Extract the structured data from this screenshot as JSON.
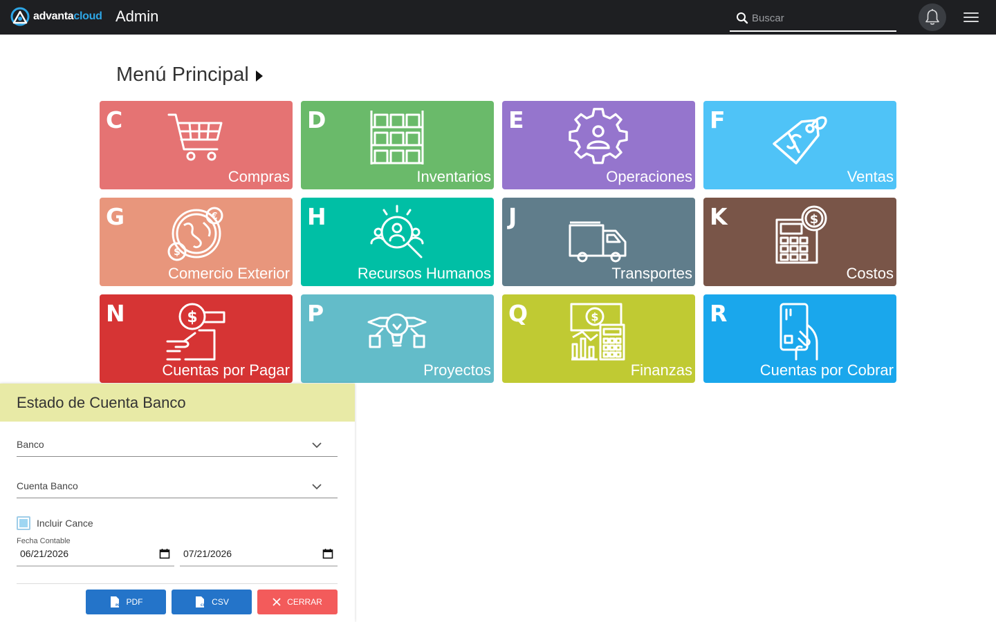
{
  "header": {
    "logo_part1": "advanta",
    "logo_part2": "cloud",
    "title": "Admin",
    "search_placeholder": "Buscar"
  },
  "menu": {
    "title": "Menú Principal"
  },
  "tiles": [
    {
      "letter": "C",
      "label": "Compras",
      "color": "#e57373",
      "icon": "shopping-cart-icon"
    },
    {
      "letter": "D",
      "label": "Inventarios",
      "color": "#6aba6a",
      "icon": "boxes-shelf-icon"
    },
    {
      "letter": "E",
      "label": "Operaciones",
      "color": "#9575cd",
      "icon": "gear-person-icon"
    },
    {
      "letter": "F",
      "label": "Ventas",
      "color": "#4fc3f7",
      "icon": "price-tag-icon"
    },
    {
      "letter": "G",
      "label": "Comercio Exterior",
      "color": "#e8967c",
      "icon": "globe-currency-icon"
    },
    {
      "letter": "H",
      "label": "Recursos Humanos",
      "color": "#00bfa5",
      "icon": "people-search-icon"
    },
    {
      "letter": "J",
      "label": "Transportes",
      "color": "#607d8b",
      "icon": "truck-icon"
    },
    {
      "letter": "K",
      "label": "Costos",
      "color": "#795548",
      "icon": "calculator-coin-icon"
    },
    {
      "letter": "N",
      "label": "Cuentas por Pagar",
      "color": "#d63434",
      "icon": "coin-hand-icon"
    },
    {
      "letter": "P",
      "label": "Proyectos",
      "color": "#63bcc9",
      "icon": "lightbulb-project-icon"
    },
    {
      "letter": "Q",
      "label": "Finanzas",
      "color": "#c0ca33",
      "icon": "finance-calculator-icon"
    },
    {
      "letter": "R",
      "label": "Cuentas por Cobrar",
      "color": "#1aa7ec",
      "icon": "card-hand-icon"
    }
  ],
  "panel": {
    "title": "Estado de Cuenta Banco",
    "banco_label": "Banco",
    "cuenta_label": "Cuenta Banco",
    "checkbox_label": "Incluir Cance",
    "date_caption": "Fecha Contable",
    "date_from": "06/21/2026",
    "date_to": "07/21/2026",
    "btn_pdf": "PDF",
    "btn_csv": "CSV",
    "btn_close": "CERRAR"
  }
}
